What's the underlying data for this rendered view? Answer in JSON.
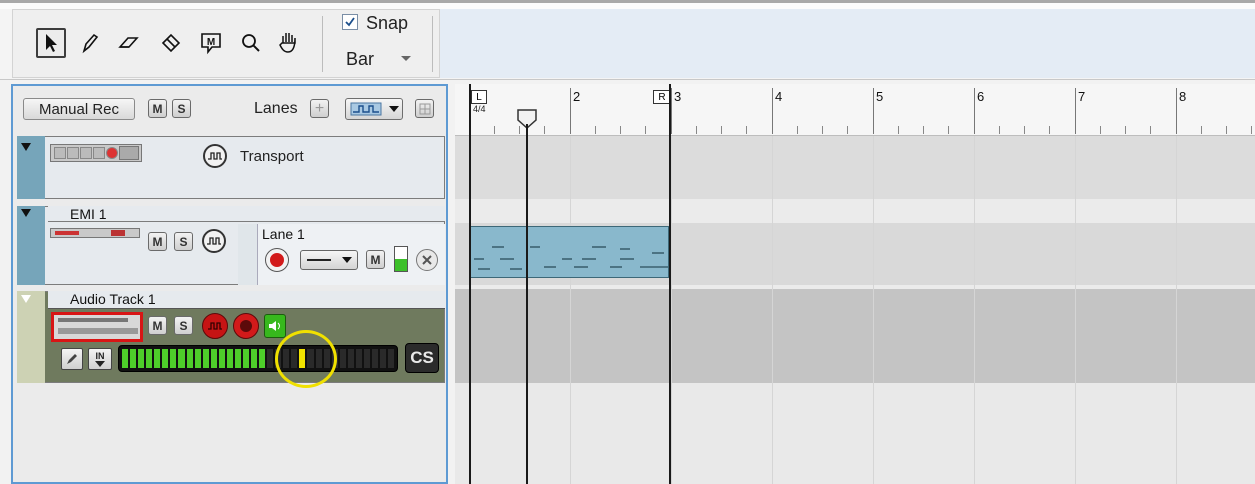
{
  "toolbar": {
    "tools": [
      {
        "name": "select-arrow-icon",
        "glyph": "➤"
      },
      {
        "name": "pencil-icon",
        "glyph": "✎"
      },
      {
        "name": "eraser-icon",
        "glyph": "⌫"
      },
      {
        "name": "split-icon",
        "glyph": "⬗"
      },
      {
        "name": "marker-icon",
        "glyph": "Ⓜ"
      },
      {
        "name": "zoom-icon",
        "glyph": "⚲"
      },
      {
        "name": "hand-icon",
        "glyph": "✋"
      }
    ],
    "snap_label": "Snap",
    "snap_checked": true,
    "snap_value": "Bar"
  },
  "track_header": {
    "manual_rec": "Manual Rec",
    "mute": "M",
    "solo": "S",
    "lanes_label": "Lanes",
    "add": "+"
  },
  "tracks": {
    "transport": {
      "name": "Transport"
    },
    "emi": {
      "name": "EMI 1",
      "lane_name": "Lane 1",
      "m": "M",
      "s": "S"
    },
    "audio": {
      "name": "Audio Track 1",
      "in_label": "IN",
      "cs_label": "CS",
      "m": "M",
      "s": "S"
    }
  },
  "ruler": {
    "bars": [
      "2",
      "3",
      "4",
      "5",
      "6",
      "7",
      "8"
    ],
    "left_marker": "L",
    "right_marker": "R",
    "time_signature": "4/4"
  },
  "colors": {
    "accent_blue": "#5e9ad3",
    "clip": "#89b8cc",
    "record_red": "#d21a1a",
    "meter_green": "#4ecf2a",
    "highlight_yellow": "#f2e400"
  }
}
